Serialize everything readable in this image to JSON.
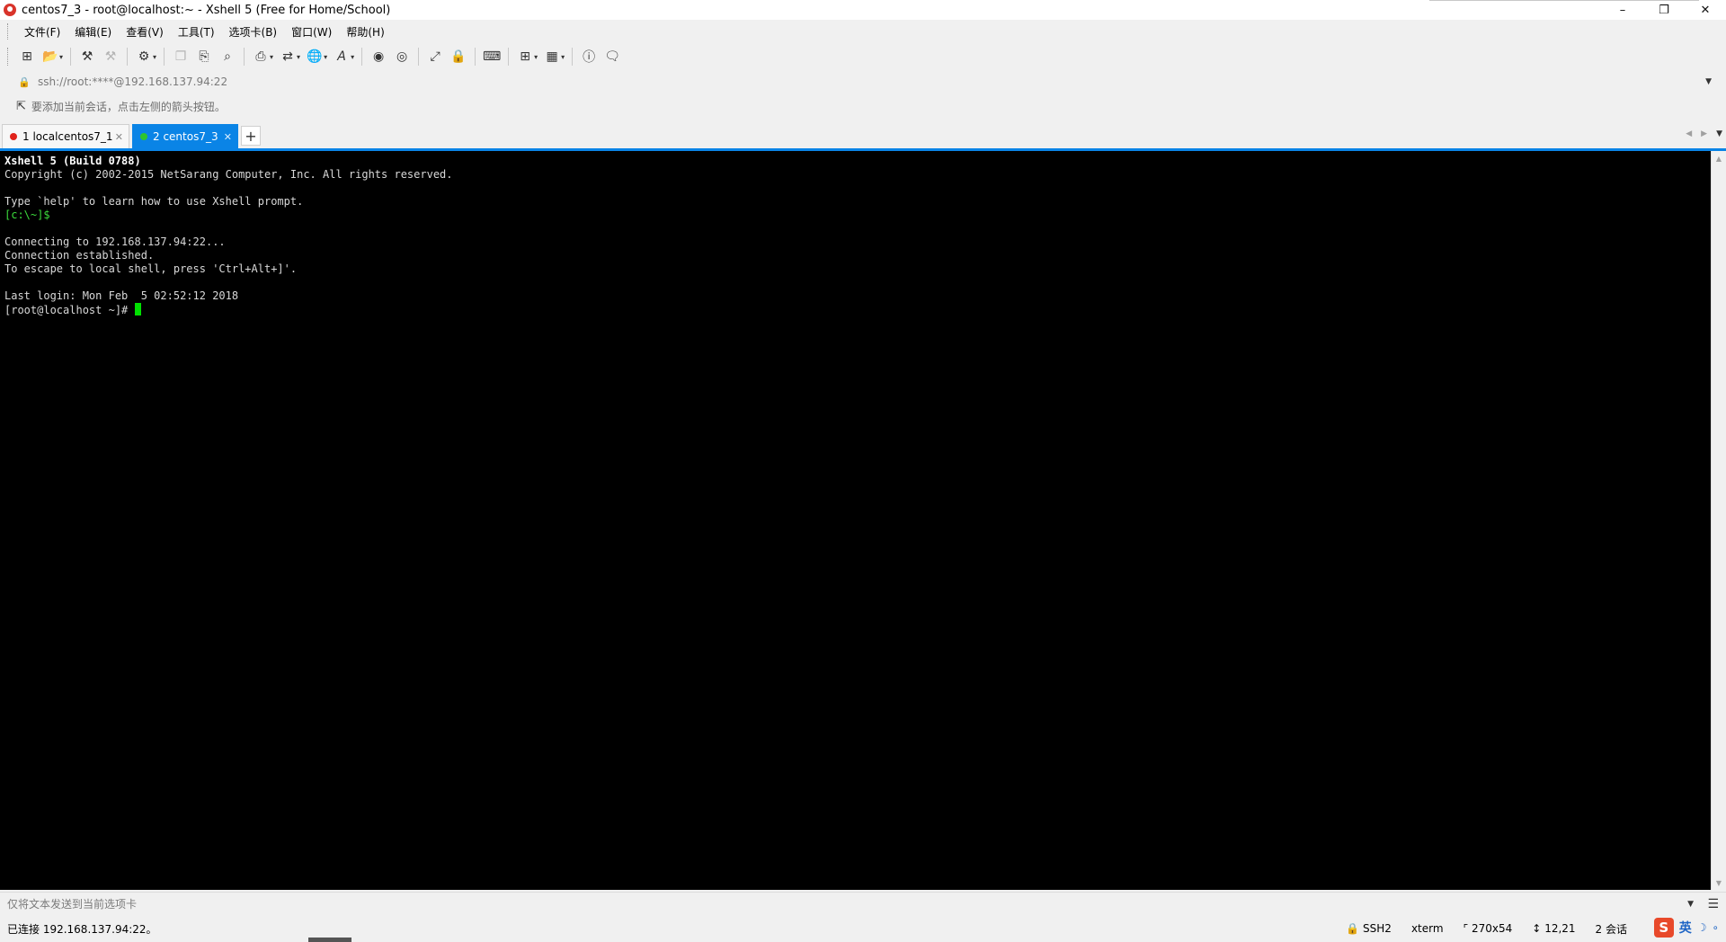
{
  "window": {
    "title": "centos7_3 - root@localhost:~ - Xshell 5 (Free for Home/School)",
    "minimize": "–",
    "restore": "❐",
    "close": "✕"
  },
  "menu": [
    "文件(F)",
    "编辑(E)",
    "查看(V)",
    "工具(T)",
    "选项卡(B)",
    "窗口(W)",
    "帮助(H)"
  ],
  "toolbar": {
    "icons": [
      "new-session-icon",
      "open-folder-icon",
      "reconnect-icon",
      "disconnect-icon",
      "properties-icon",
      "copy-icon",
      "paste-icon",
      "find-icon",
      "print-icon",
      "transfer-icon",
      "globe-icon",
      "font-icon",
      "xftp-icon",
      "script-icon",
      "fullscreen-icon",
      "lock-icon",
      "keyboard-icon",
      "add-icon",
      "layout-icon",
      "help-icon",
      "chat-icon"
    ]
  },
  "address": {
    "value": "ssh://root:****@192.168.137.94:22"
  },
  "hint": {
    "text": "要添加当前会话，点击左侧的箭头按钮。"
  },
  "tabs": [
    {
      "label": "1 localcentos7_1",
      "status_color": "#e0221b",
      "active": false
    },
    {
      "label": "2 centos7_3",
      "status_color": "#2ec52e",
      "active": true
    }
  ],
  "terminal": {
    "lines": [
      {
        "text": "Xshell 5 (Build 0788)",
        "style": "bold"
      },
      {
        "text": "Copyright (c) 2002-2015 NetSarang Computer, Inc. All rights reserved.",
        "style": "normal"
      },
      {
        "text": "",
        "style": "blank"
      },
      {
        "text": "Type `help' to learn how to use Xshell prompt.",
        "style": "normal"
      },
      {
        "text": "[c:\\~]$",
        "style": "green"
      },
      {
        "text": "",
        "style": "blank"
      },
      {
        "text": "Connecting to 192.168.137.94:22...",
        "style": "normal"
      },
      {
        "text": "Connection established.",
        "style": "normal"
      },
      {
        "text": "To escape to local shell, press 'Ctrl+Alt+]'.",
        "style": "normal"
      },
      {
        "text": "",
        "style": "blank"
      },
      {
        "text": "Last login: Mon Feb  5 02:52:12 2018",
        "style": "normal"
      }
    ],
    "prompt": "[root@localhost ~]# ",
    "cursor_color": "#00e000"
  },
  "compose": {
    "placeholder": "仅将文本发送到当前选项卡"
  },
  "status": {
    "connection": "已连接 192.168.137.94:22。",
    "protocol": "SSH2",
    "terminal_type": "xterm",
    "size": "270x54",
    "cursor_pos": "12,21",
    "sessions": "2 会话"
  },
  "ime": {
    "logo": "S",
    "lang": "英"
  },
  "colors": {
    "accent": "#0a84e6",
    "terminal_bg": "#000000",
    "prompt_green": "#3cdc3c"
  }
}
